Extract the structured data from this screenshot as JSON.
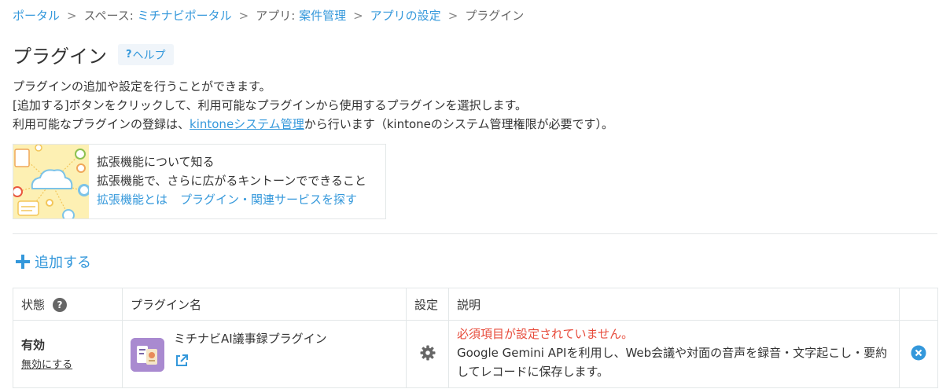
{
  "breadcrumb": {
    "portal": "ポータル",
    "space_prefix": "スペース:",
    "space_name": "ミチナビポータル",
    "app_prefix": "アプリ:",
    "app_name": "案件管理",
    "settings": "アプリの設定",
    "current": "プラグイン",
    "separator": ">"
  },
  "title": "プラグイン",
  "help": {
    "q": "?",
    "label": "ヘルプ"
  },
  "description": {
    "line1": "プラグインの追加や設定を行うことができます。",
    "line2": "[追加する]ボタンをクリックして、利用可能なプラグインから使用するプラグインを選択します。",
    "line3_pre": "利用可能なプラグインの登録は、",
    "line3_link": "kintoneシステム管理",
    "line3_post": "から行います（kintoneのシステム管理権限が必要です）。"
  },
  "extension_card": {
    "heading": "拡張機能について知る",
    "sub": "拡張機能で、さらに広がるキントーンでできること",
    "link1": "拡張機能とは",
    "link2": "プラグイン・関連サービスを探す"
  },
  "add_label": "追加する",
  "table": {
    "headers": {
      "status": "状態",
      "name": "プラグイン名",
      "settings": "設定",
      "description": "説明"
    },
    "rows": [
      {
        "status": "有効",
        "disable": "無効にする",
        "name": "ミチナビAI議事録プラグイン",
        "error": "必須項目が設定されていません。",
        "description": "Google Gemini APIを利用し、Web会議や対面の音声を録音・文字起こし・要約してレコードに保存します。"
      }
    ]
  },
  "colors": {
    "link": "#3498db",
    "error": "#e74c3c",
    "remove": "#3498db"
  }
}
